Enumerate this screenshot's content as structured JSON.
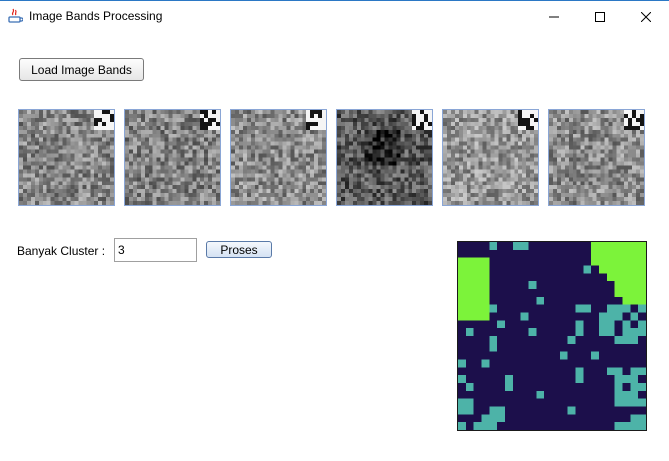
{
  "window": {
    "title": "Image Bands Processing",
    "controls": [
      "minimize-icon",
      "maximize-icon",
      "close-icon"
    ]
  },
  "toolbar": {
    "load_label": "Load Image Bands"
  },
  "bands": [
    "band-1",
    "band-2",
    "band-3",
    "band-4",
    "band-5",
    "band-6"
  ],
  "cluster": {
    "label": "Banyak Cluster :",
    "value": "3",
    "process_label": "Proses"
  },
  "result": {
    "colors": [
      "#1c0f4b",
      "#4db3a8",
      "#7cf33a"
    ]
  }
}
